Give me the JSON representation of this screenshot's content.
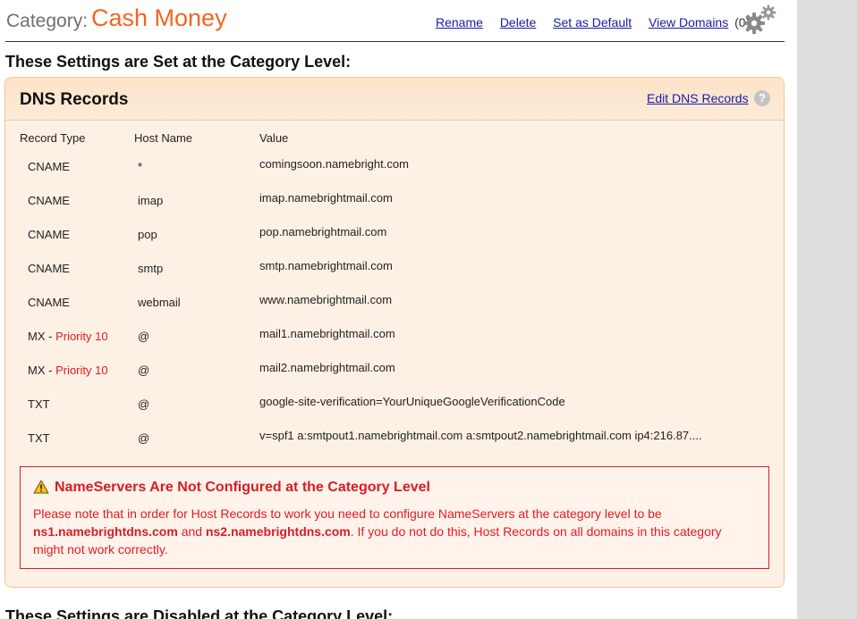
{
  "header": {
    "category_prefix": "Category:",
    "category_name": "Cash Money",
    "links": {
      "rename": "Rename",
      "delete": "Delete",
      "set_default": "Set as Default",
      "view_domains": "View Domains",
      "domain_count": "(0)"
    },
    "settings_icon": "gear-icon"
  },
  "section_enabled_title": "These Settings are Set at the Category Level:",
  "dns_panel": {
    "title": "DNS Records",
    "edit_link": "Edit DNS Records",
    "help_icon": "?",
    "columns": [
      "Record Type",
      "Host Name",
      "Value"
    ],
    "records": [
      {
        "type": "CNAME",
        "priority": "",
        "host": "*",
        "value": "comingsoon.namebright.com"
      },
      {
        "type": "CNAME",
        "priority": "",
        "host": "imap",
        "value": "imap.namebrightmail.com"
      },
      {
        "type": "CNAME",
        "priority": "",
        "host": "pop",
        "value": "pop.namebrightmail.com"
      },
      {
        "type": "CNAME",
        "priority": "",
        "host": "smtp",
        "value": "smtp.namebrightmail.com"
      },
      {
        "type": "CNAME",
        "priority": "",
        "host": "webmail",
        "value": "www.namebrightmail.com"
      },
      {
        "type": "MX - ",
        "priority": "Priority 10",
        "host": "@",
        "value": "mail1.namebrightmail.com"
      },
      {
        "type": "MX - ",
        "priority": "Priority 10",
        "host": "@",
        "value": "mail2.namebrightmail.com"
      },
      {
        "type": "TXT",
        "priority": "",
        "host": "@",
        "value": "google-site-verification=YourUniqueGoogleVerificationCode"
      },
      {
        "type": "TXT",
        "priority": "",
        "host": "@",
        "value": "v=spf1 a:smtpout1.namebrightmail.com a:smtpout2.namebrightmail.com ip4:216.87...."
      }
    ],
    "warning": {
      "icon": "warning-icon",
      "title": "NameServers Are Not Configured at the Category Level",
      "text_1": "Please note that in order for Host Records to work you need to configure NameServers at the category level to be ",
      "ns1": "ns1.namebrightdns.com",
      "text_and": " and ",
      "ns2": "ns2.namebrightdns.com",
      "text_2": ". If you do not do this, Host Records on all domains in this category might not work correctly."
    }
  },
  "section_disabled_title": "These Settings are Disabled at the Category Level:",
  "colors": {
    "accent_orange": "#f26522",
    "link_blue": "#1a1aa6",
    "warning_red": "#d81e22",
    "panel_bg": "#fdf1e5",
    "panel_border": "#f7c48f"
  }
}
